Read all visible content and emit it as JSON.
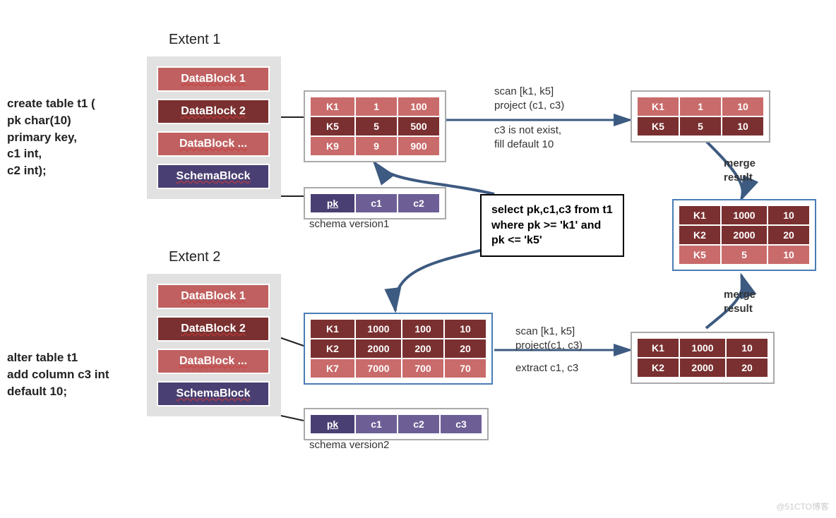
{
  "sql1": "create table t1 (\npk char(10)\nprimary key,\nc1 int,\nc2 int);",
  "sql2": "alter table t1\nadd column c3 int\ndefault 10;",
  "extent1": {
    "title": "Extent 1",
    "blocks": [
      "DataBlock 1",
      "DataBlock 2",
      "DataBlock ...",
      "SchemaBlock"
    ]
  },
  "extent2": {
    "title": "Extent 2",
    "blocks": [
      "DataBlock 1",
      "DataBlock 2",
      "DataBlock ...",
      "SchemaBlock"
    ]
  },
  "table1": {
    "rows": [
      [
        "K1",
        "1",
        "100"
      ],
      [
        "K5",
        "5",
        "500"
      ],
      [
        "K9",
        "9",
        "900"
      ]
    ]
  },
  "schema1": {
    "cols": [
      "pk",
      "c1",
      "c2"
    ],
    "caption": "schema version1"
  },
  "table2": {
    "rows": [
      [
        "K1",
        "1000",
        "100",
        "10"
      ],
      [
        "K2",
        "2000",
        "200",
        "20"
      ],
      [
        "K7",
        "7000",
        "700",
        "70"
      ]
    ]
  },
  "schema2": {
    "cols": [
      "pk",
      "c1",
      "c2",
      "c3"
    ],
    "caption": "schema version2"
  },
  "annot1": "scan [k1, k5]\nproject (c1, c3)",
  "annot1b": "c3 is not exist,\nfill default 10",
  "annot2": "scan [k1, k5]\nproject(c1, c3)",
  "annot2b": "extract c1, c3",
  "merge1": "merge\nresult",
  "merge2": "merge\nresult",
  "query": "select pk,c1,c3 from t1\nwhere pk >= 'k1' and\npk <= 'k5'",
  "proj1": {
    "rows": [
      [
        "K1",
        "1",
        "10"
      ],
      [
        "K5",
        "5",
        "10"
      ]
    ]
  },
  "proj2": {
    "rows": [
      [
        "K1",
        "1000",
        "10"
      ],
      [
        "K2",
        "2000",
        "20"
      ]
    ]
  },
  "result": {
    "rows": [
      [
        "K1",
        "1000",
        "10"
      ],
      [
        "K2",
        "2000",
        "20"
      ],
      [
        "K5",
        "5",
        "10"
      ]
    ]
  },
  "watermark": "@51CTO博客"
}
